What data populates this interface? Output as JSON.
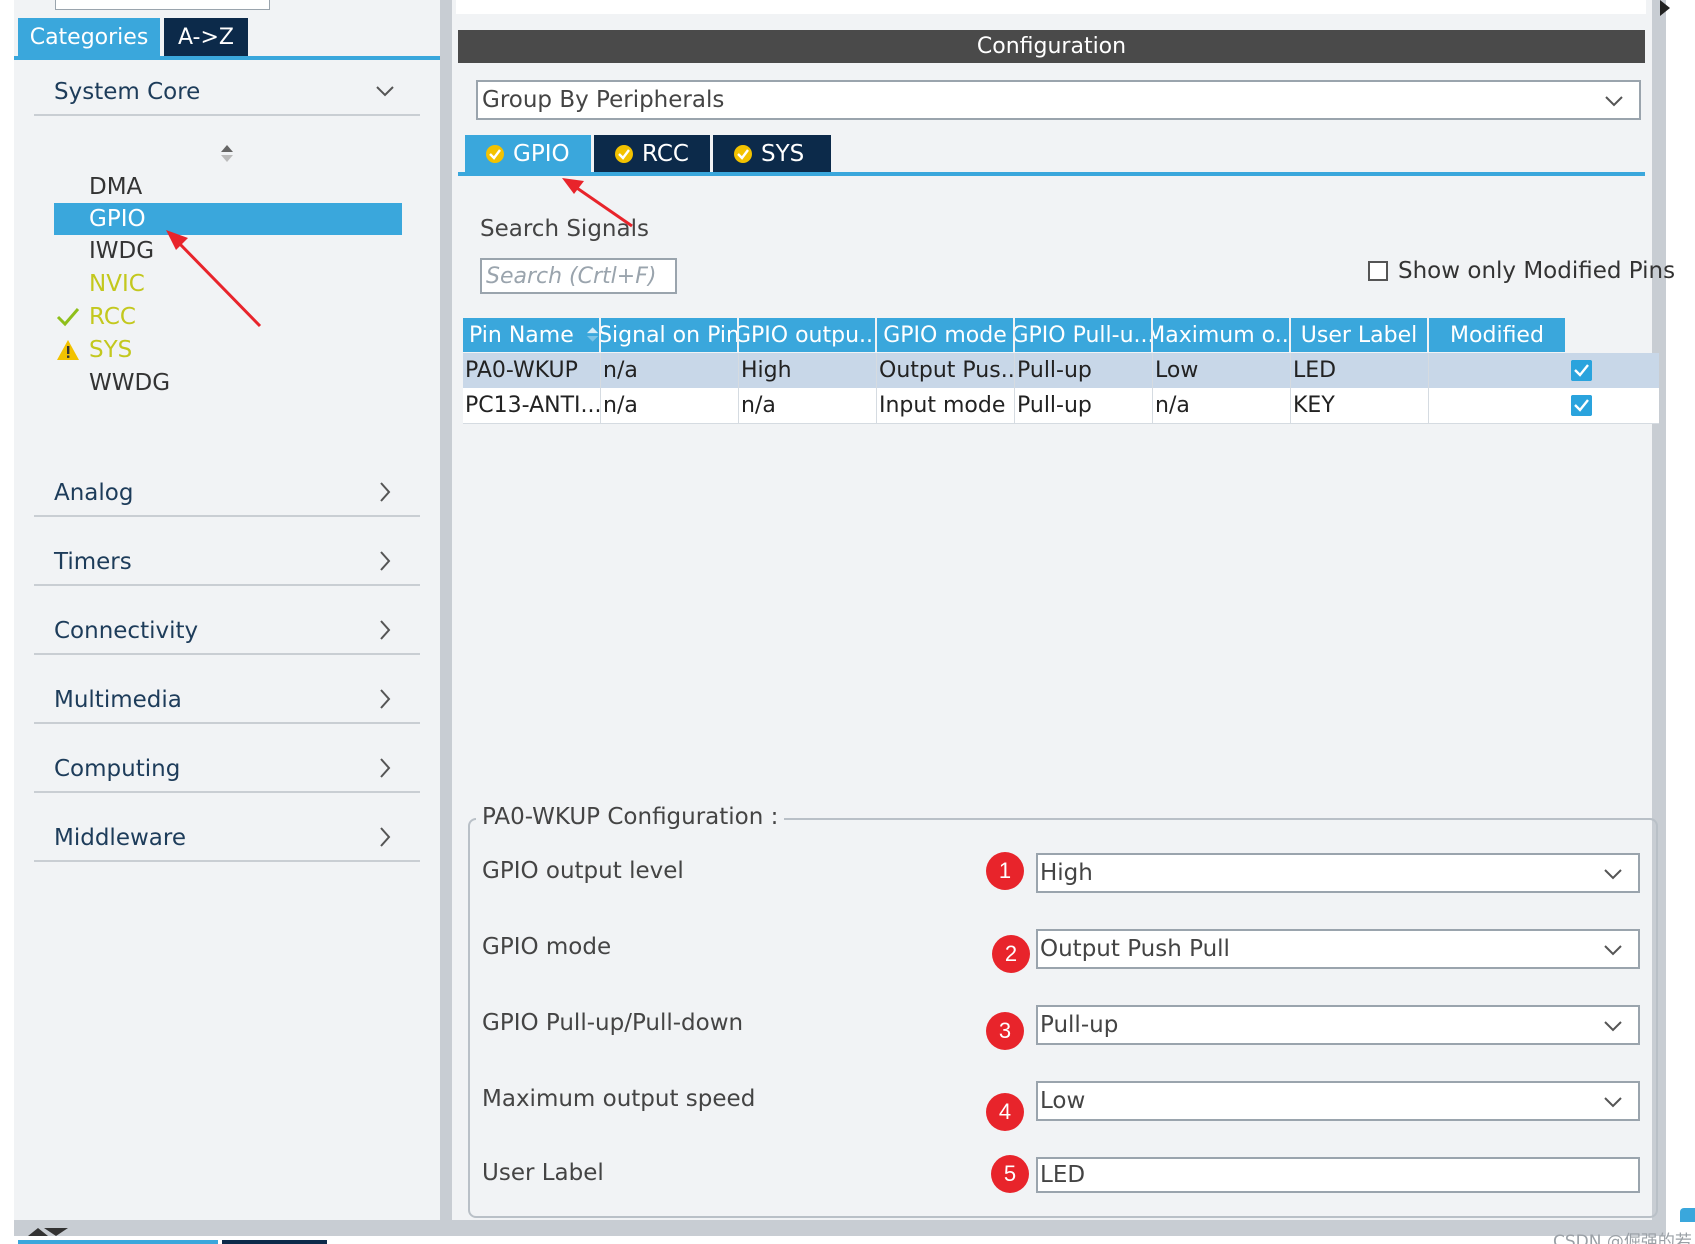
{
  "left_tabs": {
    "categories": "Categories",
    "az": "A->Z"
  },
  "categories": {
    "system_core": "System Core",
    "core_items": [
      {
        "label": "DMA",
        "state": "normal"
      },
      {
        "label": "GPIO",
        "state": "selected"
      },
      {
        "label": "IWDG",
        "state": "normal"
      },
      {
        "label": "NVIC",
        "state": "warning-color"
      },
      {
        "label": "RCC",
        "state": "check-icon"
      },
      {
        "label": "SYS",
        "state": "warning-icon"
      },
      {
        "label": "WWDG",
        "state": "normal"
      }
    ],
    "analog": "Analog",
    "timers": "Timers",
    "connectivity": "Connectivity",
    "multimedia": "Multimedia",
    "computing": "Computing",
    "middleware": "Middleware"
  },
  "config": {
    "title": "Configuration",
    "group_by": "Group By Peripherals",
    "tabs": [
      "GPIO",
      "RCC",
      "SYS"
    ],
    "search_label": "Search Signals",
    "search_placeholder": "Search (Crtl+F)",
    "show_modified_label": "Show only Modified Pins"
  },
  "table": {
    "columns": [
      "Pin Name",
      "Signal on Pin",
      "GPIO outpu...",
      "GPIO mode",
      "GPIO Pull-u...",
      "Maximum o...",
      "User Label",
      "Modified"
    ],
    "rows": [
      [
        "PA0-WKUP",
        "n/a",
        "High",
        "Output Pus...",
        "Pull-up",
        "Low",
        "LED"
      ],
      [
        "PC13-ANTI...",
        "n/a",
        "n/a",
        "Input mode",
        "Pull-up",
        "n/a",
        "KEY"
      ]
    ]
  },
  "pin_config": {
    "legend": "PA0-WKUP Configuration :",
    "fields": [
      {
        "label": "GPIO output level",
        "value": "High",
        "badge": "1"
      },
      {
        "label": "GPIO mode",
        "value": "Output Push Pull",
        "badge": "2"
      },
      {
        "label": "GPIO Pull-up/Pull-down",
        "value": "Pull-up",
        "badge": "3"
      },
      {
        "label": "Maximum output speed",
        "value": "Low",
        "badge": "4"
      },
      {
        "label": "User Label",
        "value": "LED",
        "badge": "5"
      }
    ]
  },
  "watermark": "CSDN @倔强的若",
  "colors": {
    "accent_blue": "#3aa7dc",
    "navy": "#0c2a4a",
    "header_gray": "#4a4a4a",
    "warning_yellow": "#c3c81e",
    "annotation_red": "#e8242b"
  },
  "icons": [
    "chevron-down-icon",
    "chevron-right-icon",
    "check-icon",
    "warning-icon",
    "check-circle-icon",
    "checkbox-checked-icon",
    "sort-icon",
    "scroll-arrow-icon"
  ]
}
